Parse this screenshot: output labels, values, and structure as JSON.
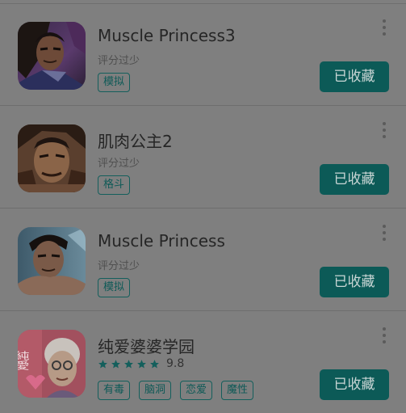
{
  "colors": {
    "button_bg": "#0c5a57",
    "tag_border": "#145f5c",
    "star": "#145f5c"
  },
  "apps": [
    {
      "title": "Muscle Princess3",
      "rating_text": "评分过少",
      "tags": [
        "模拟"
      ],
      "fav_label": "已收藏",
      "icon": "muscle-princess-3-icon"
    },
    {
      "title": "肌肉公主2",
      "rating_text": "评分过少",
      "tags": [
        "格斗"
      ],
      "fav_label": "已收藏",
      "icon": "muscle-princess-2-icon"
    },
    {
      "title": "Muscle Princess",
      "rating_text": "评分过少",
      "tags": [
        "模拟"
      ],
      "fav_label": "已收藏",
      "icon": "muscle-princess-icon"
    },
    {
      "title": "纯爱婆婆学园",
      "stars": 5,
      "score": "9.8",
      "tags": [
        "有毒",
        "脑洞",
        "恋爱",
        "魔性"
      ],
      "fav_label": "已收藏",
      "icon": "grandma-academy-icon",
      "icon_text": "純愛"
    }
  ]
}
